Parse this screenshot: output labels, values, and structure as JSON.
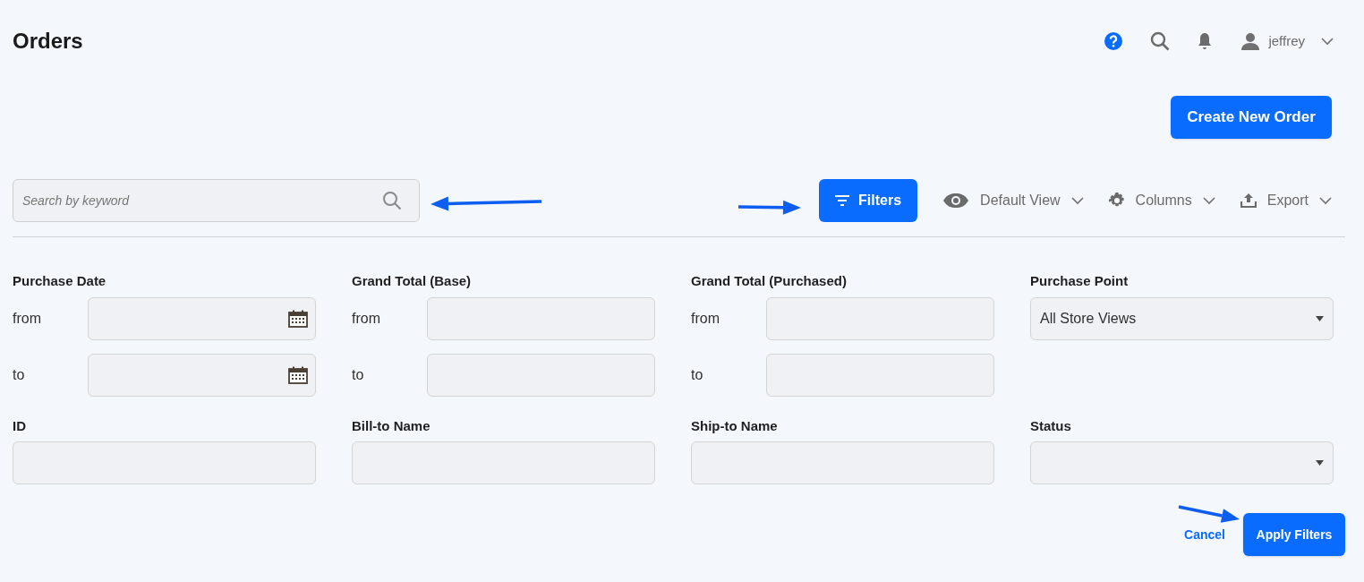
{
  "page_title": "Orders",
  "header": {
    "user": "jeffrey"
  },
  "create_button": "Create New Order",
  "search": {
    "placeholder": "Search by keyword"
  },
  "toolbar": {
    "filters_button": "Filters",
    "actions": [
      {
        "kind": "view",
        "label": "Default View"
      },
      {
        "kind": "columns",
        "label": "Columns"
      },
      {
        "kind": "export",
        "label": "Export"
      }
    ]
  },
  "filters": [
    {
      "kind": "range",
      "label": "Purchase Date",
      "calendar": true,
      "from_label": "from",
      "to_label": "to"
    },
    {
      "kind": "range",
      "label": "Grand Total (Base)",
      "calendar": false,
      "from_label": "from",
      "to_label": "to"
    },
    {
      "kind": "range",
      "label": "Grand Total (Purchased)",
      "calendar": false,
      "from_label": "from",
      "to_label": "to"
    },
    {
      "kind": "select",
      "label": "Purchase Point",
      "value": "All Store Views"
    },
    {
      "kind": "text",
      "label": "ID"
    },
    {
      "kind": "text",
      "label": "Bill-to Name"
    },
    {
      "kind": "text",
      "label": "Ship-to Name"
    },
    {
      "kind": "select",
      "label": "Status"
    }
  ],
  "cancel": "Cancel",
  "apply": "Apply Filters"
}
